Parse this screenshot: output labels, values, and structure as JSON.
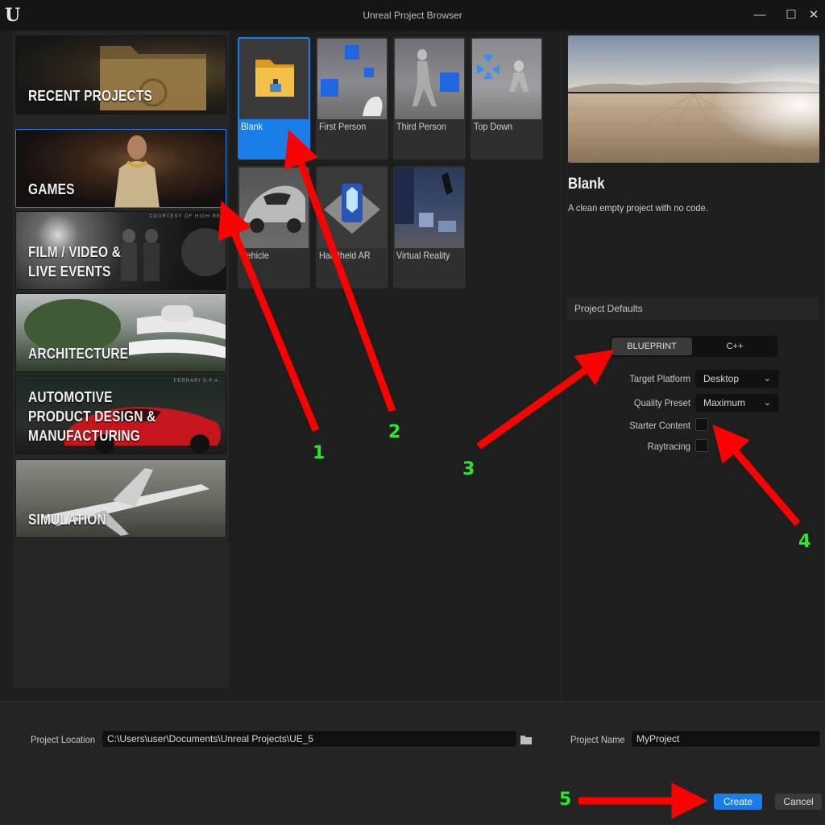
{
  "window": {
    "title": "Unreal Project Browser",
    "controls": {
      "minimize": "—",
      "maximize": "☐",
      "close": "✕"
    }
  },
  "categories": [
    {
      "label": "RECENT PROJECTS",
      "credit": ""
    },
    {
      "label": "GAMES",
      "credit": ""
    },
    {
      "label": "FILM / VIDEO &\nLIVE EVENTS",
      "credit": "COURTESY OF HIGH RE"
    },
    {
      "label": "ARCHITECTURE",
      "credit": "TILTPIXEL"
    },
    {
      "label": "AUTOMOTIVE\nPRODUCT DESIGN &\nMANUFACTURING",
      "credit": "FERRARI S.P.A."
    },
    {
      "label": "SIMULATION",
      "credit": ""
    }
  ],
  "selected_category": "GAMES",
  "templates": [
    {
      "label": "Blank"
    },
    {
      "label": "First Person"
    },
    {
      "label": "Third Person"
    },
    {
      "label": "Top Down"
    },
    {
      "label": "Vehicle"
    },
    {
      "label": "Handheld AR"
    },
    {
      "label": "Virtual Reality"
    }
  ],
  "details": {
    "title": "Blank",
    "description": "A clean empty project with no code.",
    "defaults_header": "Project Defaults",
    "language_options": [
      "BLUEPRINT",
      "C++"
    ],
    "selected_language": "BLUEPRINT",
    "target_platform_label": "Target Platform",
    "target_platform_value": "Desktop",
    "quality_preset_label": "Quality Preset",
    "quality_preset_value": "Maximum",
    "starter_content_label": "Starter Content",
    "starter_content_checked": false,
    "raytracing_label": "Raytracing",
    "raytracing_checked": false
  },
  "bottom": {
    "location_label": "Project Location",
    "location_value": "C:\\Users\\user\\Documents\\Unreal Projects\\UE_5",
    "name_label": "Project Name",
    "name_value": "MyProject",
    "create_label": "Create",
    "cancel_label": "Cancel"
  },
  "annotations": {
    "numbers": [
      "1",
      "2",
      "3",
      "4",
      "5"
    ],
    "arrow_color": "#ff0000",
    "number_color": "#2ee62e"
  },
  "colors": {
    "accent": "#1a7ee8",
    "panel": "#262626",
    "background": "#1e1e1e"
  }
}
